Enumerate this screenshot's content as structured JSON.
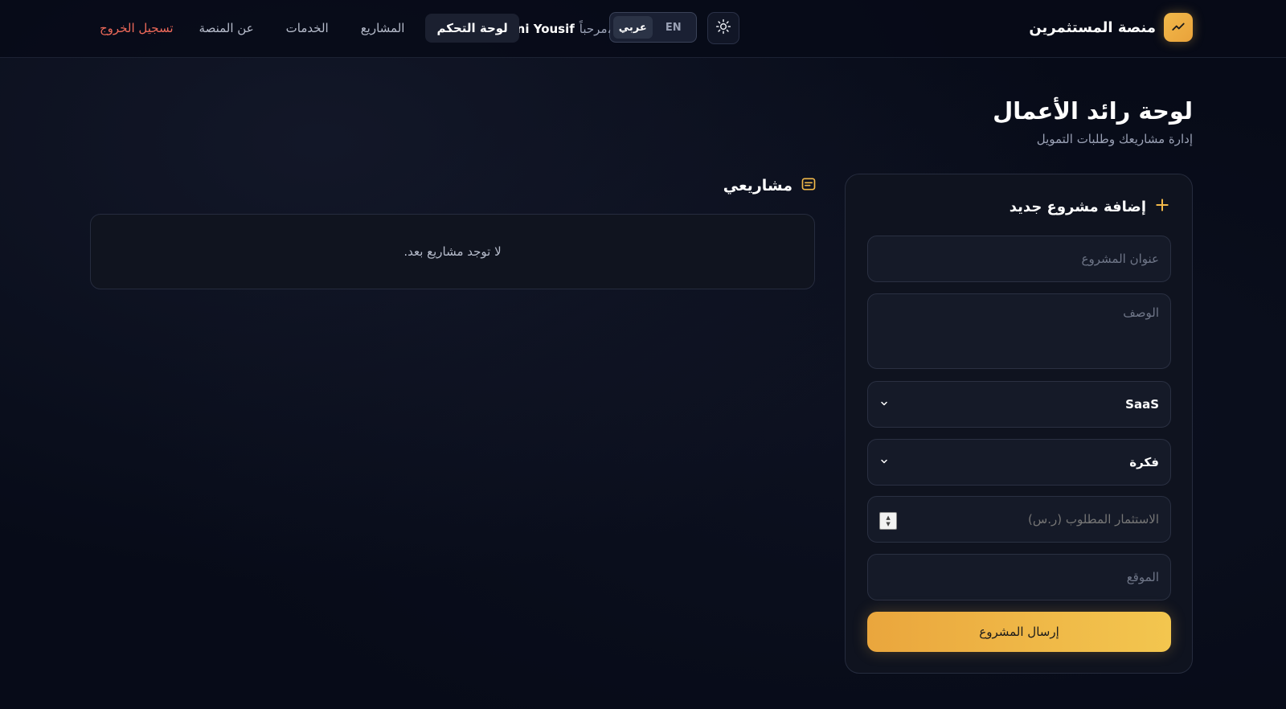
{
  "header": {
    "brand": "منصة المستثمرين",
    "brand_icon": "trend-line-icon",
    "lang": {
      "en": "EN",
      "ar": "عربي",
      "active": "ar"
    },
    "welcome": {
      "greeting": "مرحباً،",
      "user": "Hani Yousif"
    },
    "nav": {
      "dashboard": "لوحة التحكم",
      "projects": "المشاريع",
      "services": "الخدمات",
      "about": "عن المنصة",
      "logout": "تسجيل الخروج"
    }
  },
  "page": {
    "title": "لوحة رائد الأعمال",
    "subtitle": "إدارة مشاريعك وطلبات التمويل"
  },
  "projects": {
    "title": "مشاريعي",
    "empty": "لا توجد مشاريع بعد."
  },
  "form": {
    "title": "إضافة مشروع جديد",
    "title_placeholder": "عنوان المشروع",
    "description_placeholder": "الوصف",
    "category_value": "SaaS",
    "stage_value": "فكرة",
    "investment_placeholder": "الاستثمار المطلوب (ر.س)",
    "location_placeholder": "الموقع",
    "submit": "إرسال المشروع"
  },
  "colors": {
    "accent": "#F2B94A",
    "logout": "#F06A5A",
    "background": "#070B18"
  }
}
